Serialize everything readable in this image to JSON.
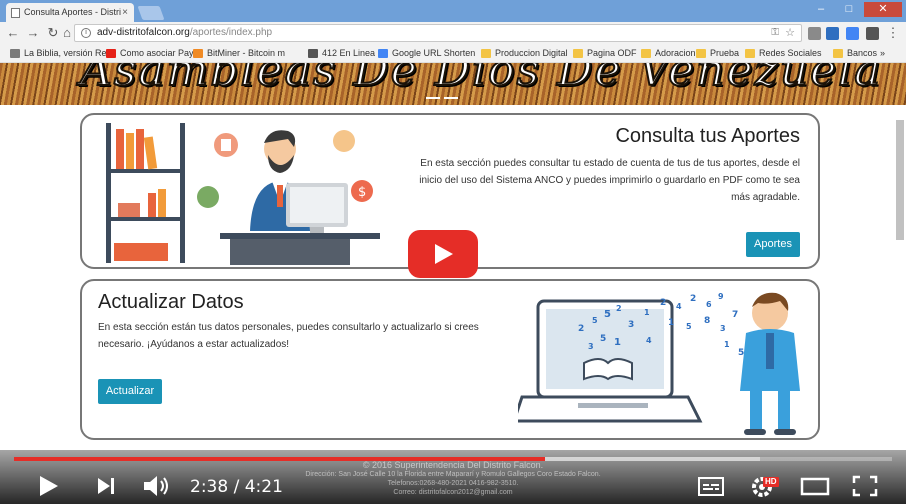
{
  "browser": {
    "tab_title": "Consulta Aportes - Distri",
    "tab_close": "×",
    "url_host": "adv-distritofalcon.org",
    "url_path": "/aportes/index.php",
    "bookmarks": [
      {
        "label": "La Biblia, versión Re",
        "color": "#7a7a7a"
      },
      {
        "label": "Como asociar Payon",
        "color": "#e62117"
      },
      {
        "label": "BitMiner - Bitcoin m",
        "color": "#f08a24"
      },
      {
        "label": "412 En Linea",
        "color": "#555555"
      },
      {
        "label": "Google URL Shorten",
        "color": "#4285f4"
      },
      {
        "label": "Produccion Digital",
        "color": "#f3c444"
      },
      {
        "label": "Pagina ODF",
        "color": "#f3c444"
      },
      {
        "label": "Adoracion",
        "color": "#f3c444"
      },
      {
        "label": "Prueba",
        "color": "#f3c444"
      },
      {
        "label": "Redes Sociales",
        "color": "#f3c444"
      },
      {
        "label": "Bancos",
        "color": "#f3c444"
      }
    ],
    "more": "»"
  },
  "page": {
    "banner_text": "Asambleas De Dios De Venezuela",
    "aportes": {
      "title": "Consulta tus Aportes",
      "description": "En esta sección puedes consultar tu estado de cuenta de tus de tus aportes, desde el inicio del uso del Sistema ANCO y puedes imprimirlo o guardarlo en PDF como te sea más agradable.",
      "button": "Aportes"
    },
    "actualizar": {
      "title": "Actualizar Datos",
      "description": "En esta sección están tus datos personales, puedes consultarlo y actualizarlo si crees necesario. ¡Ayúdanos a estar actualizados!",
      "button": "Actualizar"
    },
    "footer_lines": [
      "© 2016 Superintendencia Del Distrito Falcon.",
      "Dirección: San José Calle 10 la Florida entre Mapararí y Romulo Gallegos Coro Estado Falcon.",
      "Telefonos:0268-480-2021 0416-982-3510.",
      "Correo: distritofalcon2012@gmail.com"
    ]
  },
  "player": {
    "current_time": "2:38",
    "duration": "4:21",
    "time_display": "2:38 / 4:21",
    "progress_fraction": 0.605,
    "buffered_fraction": 0.85,
    "hd_badge": "HD",
    "accent_color": "#e52d27"
  }
}
